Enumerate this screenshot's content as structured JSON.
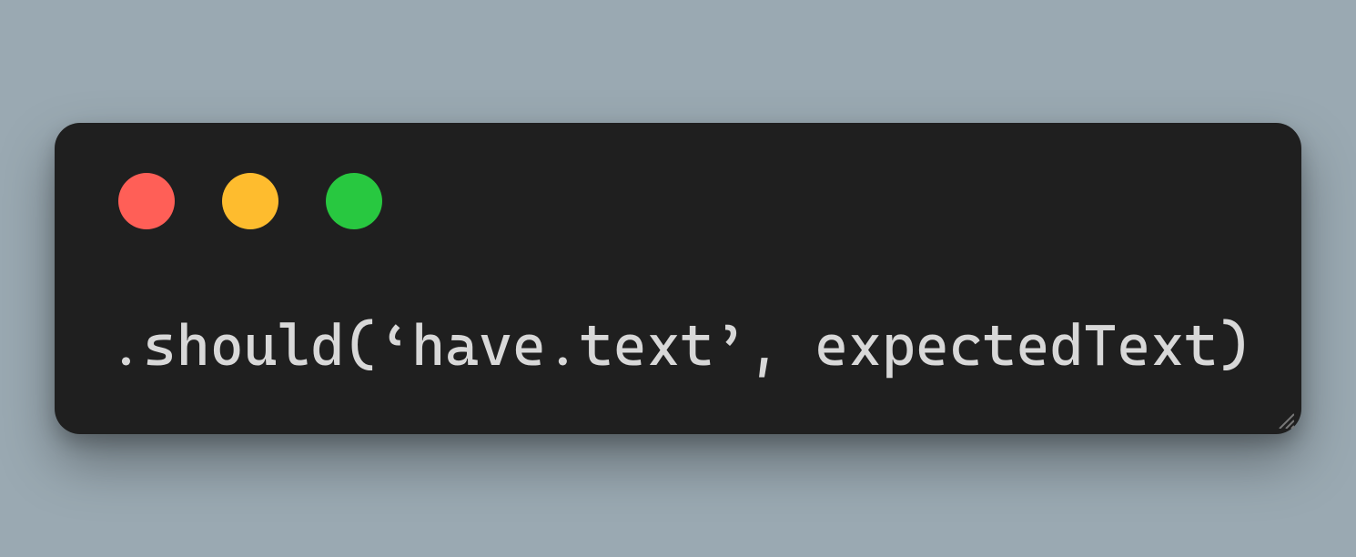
{
  "window": {
    "traffic_lights": {
      "close_color": "#ff5f57",
      "minimize_color": "#febc2e",
      "zoom_color": "#28c840"
    }
  },
  "code": {
    "line1": ".should(‘have.text’, expectedText)"
  },
  "colors": {
    "page_bg": "#9aa9b2",
    "window_bg": "#1f1f1f",
    "text": "#d8d8d8"
  }
}
